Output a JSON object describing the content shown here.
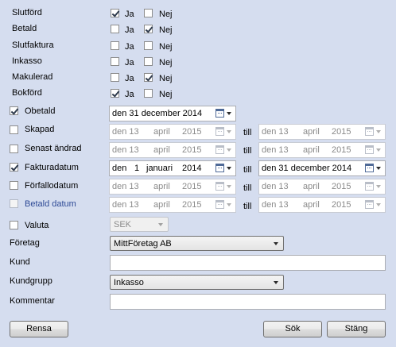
{
  "status_rows": [
    {
      "label": "Slutförd",
      "ja_label": "Ja",
      "nej_label": "Nej",
      "ja": true,
      "nej": false
    },
    {
      "label": "Betald",
      "ja_label": "Ja",
      "nej_label": "Nej",
      "ja": false,
      "nej": true
    },
    {
      "label": "Slutfaktura",
      "ja_label": "Ja",
      "nej_label": "Nej",
      "ja": false,
      "nej": false
    },
    {
      "label": "Inkasso",
      "ja_label": "Ja",
      "nej_label": "Nej",
      "ja": false,
      "nej": false
    },
    {
      "label": "Makulerad",
      "ja_label": "Ja",
      "nej_label": "Nej",
      "ja": false,
      "nej": true
    },
    {
      "label": "Bokförd",
      "ja_label": "Ja",
      "nej_label": "Nej",
      "ja": true,
      "nej": false
    }
  ],
  "date_filters": {
    "till_label": "till",
    "obetald": {
      "label": "Obetald",
      "checked": true,
      "date": "den 31 december 2014"
    },
    "skapad": {
      "label": "Skapad",
      "checked": false,
      "from": {
        "p1": "den 13",
        "p2": "april",
        "p3": "2015"
      },
      "to": {
        "p1": "den 13",
        "p2": "april",
        "p3": "2015"
      }
    },
    "senast_andrad": {
      "label": "Senast ändrad",
      "checked": false,
      "from": {
        "p1": "den 13",
        "p2": "april",
        "p3": "2015"
      },
      "to": {
        "p1": "den 13",
        "p2": "april",
        "p3": "2015"
      }
    },
    "fakturadatum": {
      "label": "Fakturadatum",
      "checked": true,
      "from": {
        "p1": "den",
        "p2": "1",
        "p3": "januari",
        "p4": "2014"
      },
      "to": "den 31 december 2014"
    },
    "forfallodatum": {
      "label": "Förfallodatum",
      "checked": false,
      "from": {
        "p1": "den 13",
        "p2": "april",
        "p3": "2015"
      },
      "to": {
        "p1": "den 13",
        "p2": "april",
        "p3": "2015"
      }
    },
    "betald_datum": {
      "label": "Betald datum",
      "checked": false,
      "from": {
        "p1": "den 13",
        "p2": "april",
        "p3": "2015"
      },
      "to": {
        "p1": "den 13",
        "p2": "april",
        "p3": "2015"
      }
    }
  },
  "valuta": {
    "label": "Valuta",
    "checked": false,
    "value": "SEK"
  },
  "foretag": {
    "label": "Företag",
    "value": "MittFöretag AB"
  },
  "kund": {
    "label": "Kund",
    "value": ""
  },
  "kundgrupp": {
    "label": "Kundgrupp",
    "value": "Inkasso"
  },
  "kommentar": {
    "label": "Kommentar",
    "value": ""
  },
  "buttons": {
    "rensa": "Rensa",
    "sok": "Sök",
    "stang": "Stäng"
  }
}
